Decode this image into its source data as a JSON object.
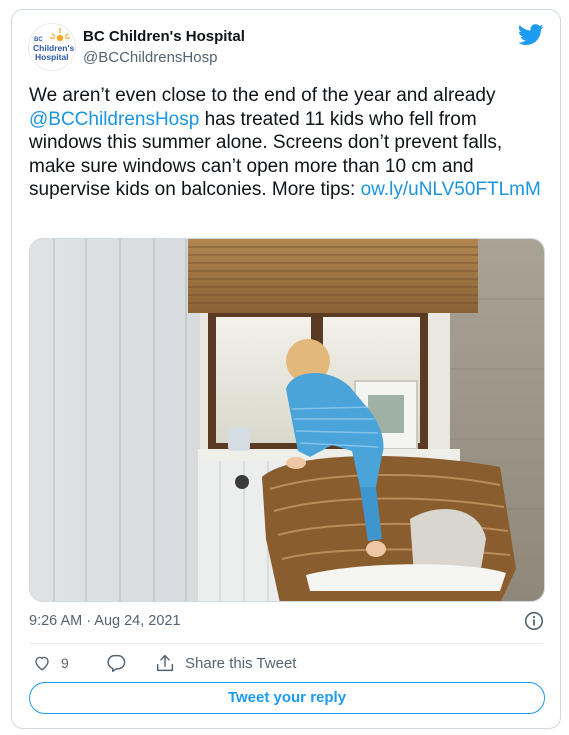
{
  "author": {
    "name": "BC Children's Hospital",
    "handle": "@BCChildrensHosp",
    "avatar_logo_text": [
      "BC",
      "Children's",
      "Hospital"
    ]
  },
  "tweet": {
    "text_parts": {
      "p1": "We aren’t even close to the end of the year and already ",
      "mention": "@BCChildrensHosp",
      "p2": " has treated 11 kids who fell from windows this summer alone. Screens don’t prevent falls, make sure windows can’t open more than 10 cm and supervise kids on balconies. More tips: ",
      "url": "ow.ly/uNLV50FTLmM"
    },
    "photo_description": "Toddler in blue pyjamas climbing a wicker chair to reach an open window",
    "timestamp": "9:26 AM · Aug 24, 2021"
  },
  "actions": {
    "like_count": "9",
    "share_label": "Share this Tweet",
    "reply_button_label": "Tweet your reply"
  },
  "colors": {
    "link": "#1b95e0",
    "accent": "#1d9bf0",
    "muted": "#536471",
    "border": "#cfd9de"
  },
  "icons": [
    "twitter-bird-icon",
    "info-icon",
    "heart-icon",
    "reply-bubble-icon",
    "share-icon"
  ]
}
